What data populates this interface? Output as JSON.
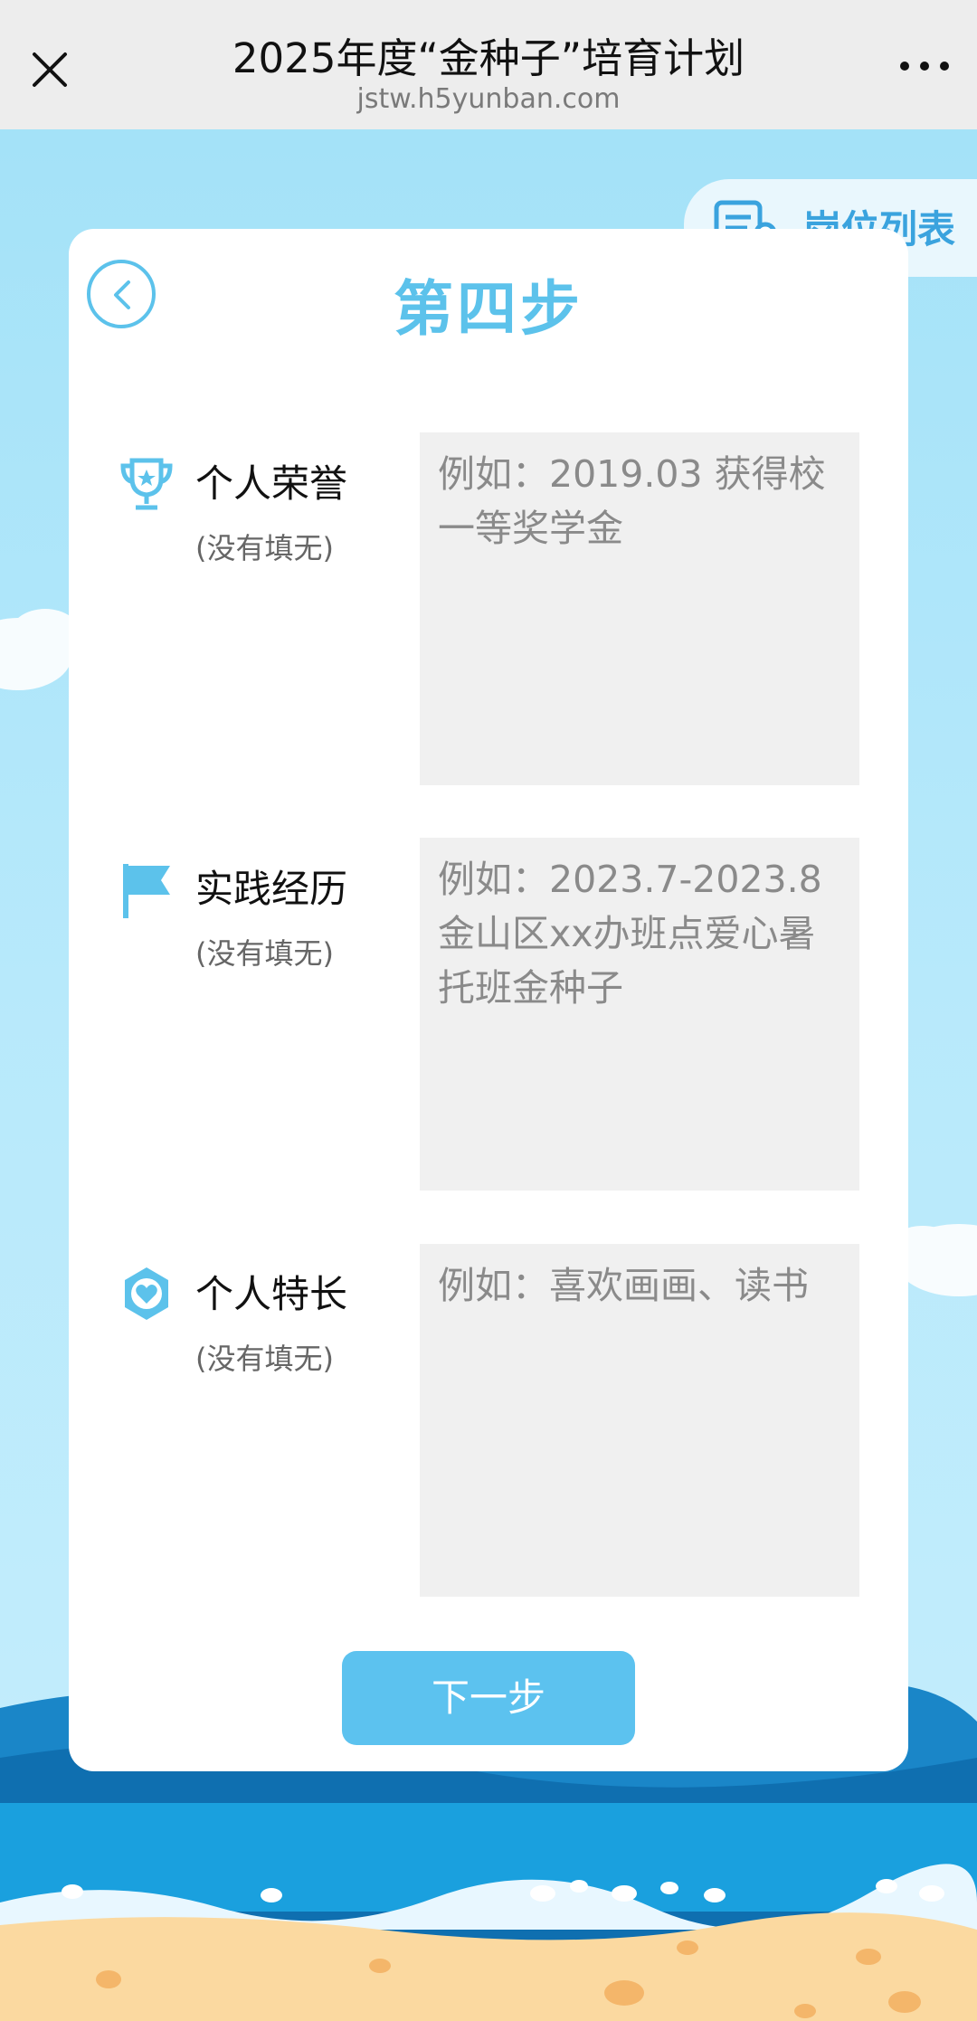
{
  "topbar": {
    "title": "2025年度“金种子”培育计划",
    "domain": "jstw.h5yunban.com"
  },
  "page": {
    "step_title": "第四步",
    "job_list_label": "岗位列表",
    "next_label": "下一步"
  },
  "fields": [
    {
      "label": "个人荣誉",
      "hint": "(没有填无)",
      "placeholder": "例如：2019.03 获得校一等奖学金",
      "icon": "trophy-icon"
    },
    {
      "label": "实践经历",
      "hint": "(没有填无)",
      "placeholder": "例如：2023.7-2023.8 金山区xx办班点爱心暑托班金种子",
      "icon": "flag-icon"
    },
    {
      "label": "个人特长",
      "hint": "(没有填无)",
      "placeholder": "例如：喜欢画画、读书",
      "icon": "heart-badge-icon"
    }
  ],
  "colors": {
    "accent": "#5cc2eb",
    "button": "#5cc2ef",
    "joblist_text": "#3aa3de"
  }
}
